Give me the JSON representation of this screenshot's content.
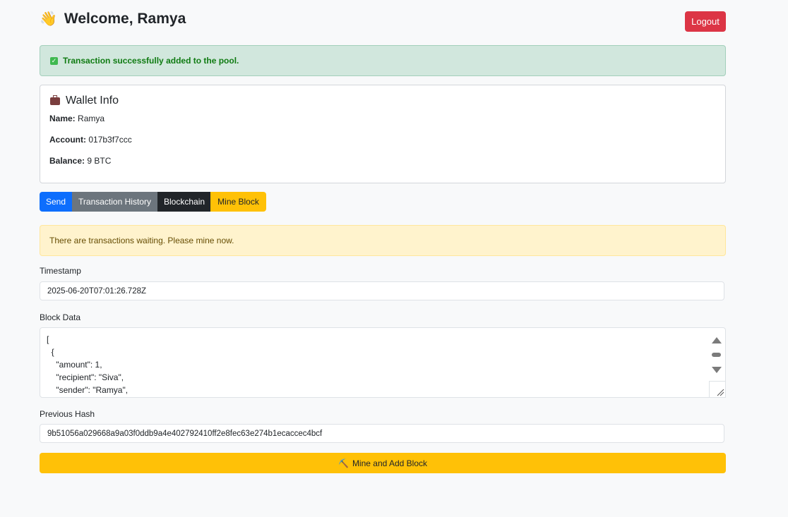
{
  "header": {
    "wave_emoji": "👋",
    "title": "Welcome, Ramya",
    "logout_label": "Logout"
  },
  "success_alert": {
    "icon": "checkbox-icon",
    "text": "Transaction successfully added to the pool."
  },
  "wallet": {
    "icon": "briefcase-icon",
    "title": "Wallet Info",
    "name_label": "Name:",
    "name_value": "Ramya",
    "account_label": "Account:",
    "account_value": "017b3f7ccc",
    "balance_label": "Balance:",
    "balance_value": "9 BTC"
  },
  "tabs": [
    {
      "label": "Send",
      "color": "#0d6efd"
    },
    {
      "label": "Transaction History",
      "color": "#6c757d"
    },
    {
      "label": "Blockchain",
      "color": "#212529"
    },
    {
      "label": "Mine Block",
      "color": "#ffc107"
    }
  ],
  "warning_alert": {
    "text": "There are transactions waiting. Please mine now."
  },
  "form": {
    "timestamp_label": "Timestamp",
    "timestamp_value": "2025-06-20T07:01:26.728Z",
    "block_data_label": "Block Data",
    "block_data_lines": [
      "[",
      "  {",
      "    \"amount\": 1,",
      "    \"recipient\": \"Siva\",",
      "    \"sender\": \"Ramya\","
    ],
    "previous_hash_label": "Previous Hash",
    "previous_hash_value": "9b51056a029668a9a03f0ddb9a4e402792410ff2e8fec63e274b1ecaccec4bcf",
    "submit_icon": "⛏️",
    "submit_label": "Mine and Add Block"
  }
}
